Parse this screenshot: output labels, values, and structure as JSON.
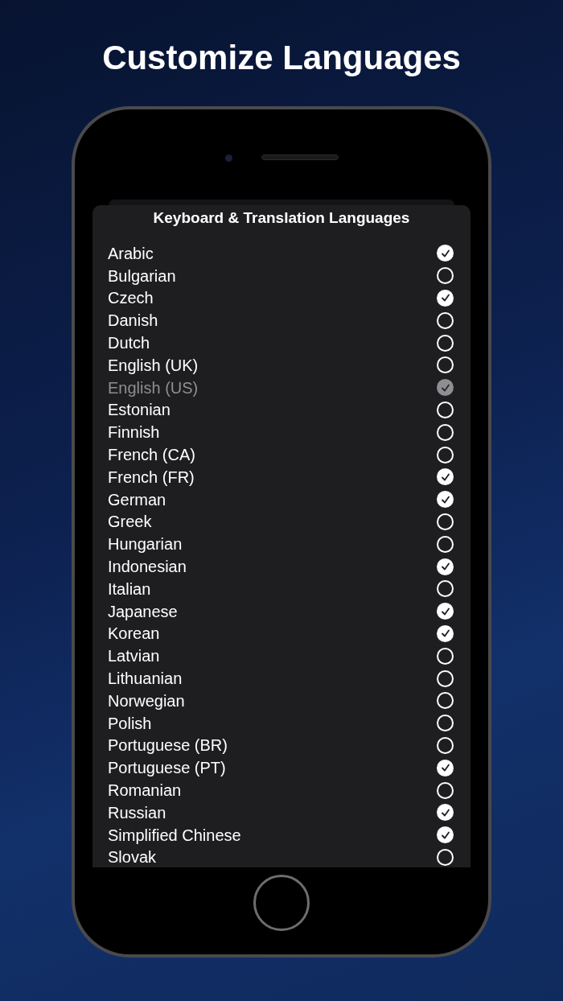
{
  "headline": "Customize Languages",
  "sheet": {
    "title": "Keyboard & Translation Languages",
    "languages": [
      {
        "name": "Arabic",
        "checked": true,
        "disabled": false
      },
      {
        "name": "Bulgarian",
        "checked": false,
        "disabled": false
      },
      {
        "name": "Czech",
        "checked": true,
        "disabled": false
      },
      {
        "name": "Danish",
        "checked": false,
        "disabled": false
      },
      {
        "name": "Dutch",
        "checked": false,
        "disabled": false
      },
      {
        "name": "English (UK)",
        "checked": false,
        "disabled": false
      },
      {
        "name": "English (US)",
        "checked": true,
        "disabled": true
      },
      {
        "name": "Estonian",
        "checked": false,
        "disabled": false
      },
      {
        "name": "Finnish",
        "checked": false,
        "disabled": false
      },
      {
        "name": "French (CA)",
        "checked": false,
        "disabled": false
      },
      {
        "name": "French (FR)",
        "checked": true,
        "disabled": false
      },
      {
        "name": "German",
        "checked": true,
        "disabled": false
      },
      {
        "name": "Greek",
        "checked": false,
        "disabled": false
      },
      {
        "name": "Hungarian",
        "checked": false,
        "disabled": false
      },
      {
        "name": "Indonesian",
        "checked": true,
        "disabled": false
      },
      {
        "name": "Italian",
        "checked": false,
        "disabled": false
      },
      {
        "name": "Japanese",
        "checked": true,
        "disabled": false
      },
      {
        "name": "Korean",
        "checked": true,
        "disabled": false
      },
      {
        "name": "Latvian",
        "checked": false,
        "disabled": false
      },
      {
        "name": "Lithuanian",
        "checked": false,
        "disabled": false
      },
      {
        "name": "Norwegian",
        "checked": false,
        "disabled": false
      },
      {
        "name": "Polish",
        "checked": false,
        "disabled": false
      },
      {
        "name": "Portuguese (BR)",
        "checked": false,
        "disabled": false
      },
      {
        "name": "Portuguese (PT)",
        "checked": true,
        "disabled": false
      },
      {
        "name": "Romanian",
        "checked": false,
        "disabled": false
      },
      {
        "name": "Russian",
        "checked": true,
        "disabled": false
      },
      {
        "name": "Simplified Chinese",
        "checked": true,
        "disabled": false
      },
      {
        "name": "Slovak",
        "checked": false,
        "disabled": false
      }
    ]
  }
}
